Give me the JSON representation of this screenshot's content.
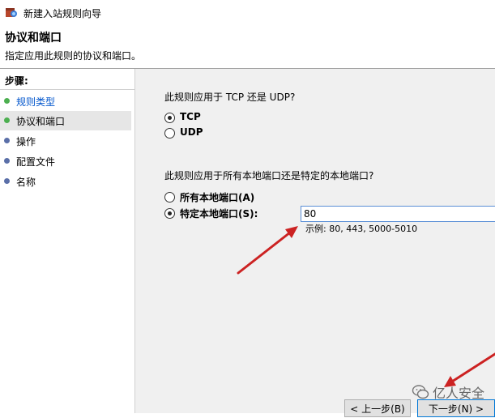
{
  "window": {
    "title": "新建入站规则向导"
  },
  "header": {
    "title": "协议和端口",
    "subtitle": "指定应用此规则的协议和端口。"
  },
  "sidebar": {
    "label": "步骤:",
    "items": [
      {
        "label": "规则类型",
        "bullet_color": "#4caf50",
        "link_color": "#0055cc"
      },
      {
        "label": "协议和端口",
        "bullet_color": "#4caf50",
        "link_color": "#000000"
      },
      {
        "label": "操作",
        "bullet_color": "#5a6fa8",
        "link_color": "#000000"
      },
      {
        "label": "配置文件",
        "bullet_color": "#5a6fa8",
        "link_color": "#000000"
      },
      {
        "label": "名称",
        "bullet_color": "#5a6fa8",
        "link_color": "#000000"
      }
    ]
  },
  "protocol": {
    "question": "此规则应用于 TCP 还是 UDP?",
    "options": [
      {
        "label": "TCP",
        "checked": true
      },
      {
        "label": "UDP",
        "checked": false
      }
    ]
  },
  "ports": {
    "question": "此规则应用于所有本地端口还是特定的本地端口?",
    "options": [
      {
        "label": "所有本地端口(A)",
        "checked": false
      },
      {
        "label": "特定本地端口(S):",
        "checked": true
      }
    ],
    "value": "80",
    "example": "示例: 80, 443, 5000-5010"
  },
  "buttons": {
    "back": "< 上一步(B)",
    "next": "下一步(N) >"
  },
  "watermark": {
    "text": "亿人安全"
  },
  "colors": {
    "arrow": "#cc2222",
    "accent": "#0078d7"
  }
}
